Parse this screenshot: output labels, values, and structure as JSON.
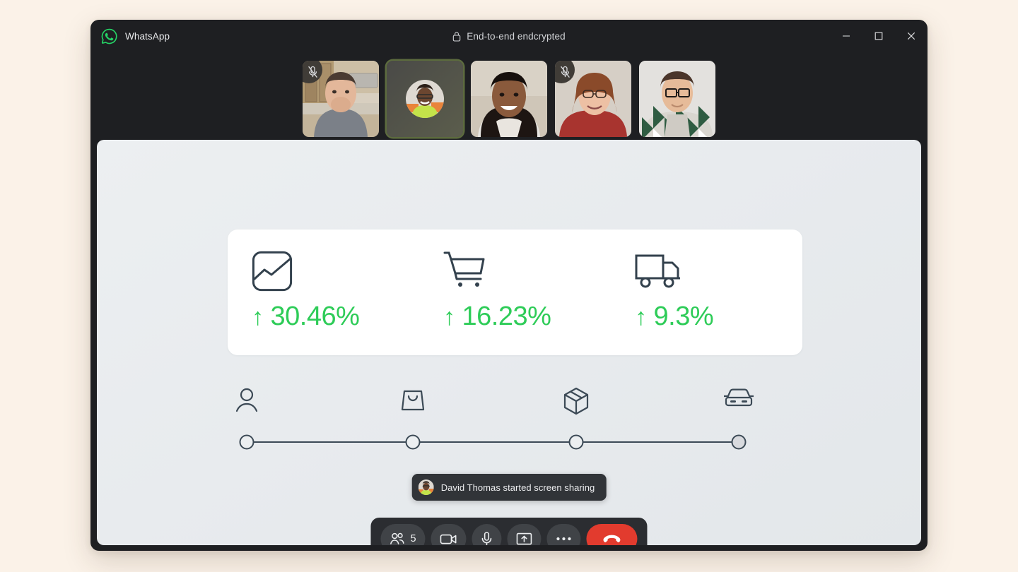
{
  "window": {
    "app_name": "WhatsApp",
    "encryption_label": "End-to-end endcrypted",
    "lock_icon": "lock-icon",
    "logo_icon": "whatsapp-logo-icon",
    "controls": {
      "minimize": "minimize-icon",
      "maximize": "maximize-icon",
      "close": "close-icon"
    }
  },
  "participants": [
    {
      "id": "p1",
      "camera_on": true,
      "muted": true,
      "active_speaker": false,
      "mute_icon": "mic-off-icon"
    },
    {
      "id": "p2",
      "camera_on": false,
      "muted": false,
      "active_speaker": true,
      "mute_icon": ""
    },
    {
      "id": "p3",
      "camera_on": true,
      "muted": false,
      "active_speaker": false,
      "mute_icon": ""
    },
    {
      "id": "p4",
      "camera_on": true,
      "muted": true,
      "active_speaker": false,
      "mute_icon": "mic-off-icon"
    },
    {
      "id": "p5",
      "camera_on": true,
      "muted": false,
      "active_speaker": false,
      "mute_icon": ""
    }
  ],
  "shared_screen": {
    "stats": [
      {
        "icon": "chart-image-icon",
        "direction": "up",
        "arrow": "↑",
        "value": "30.46%"
      },
      {
        "icon": "shopping-cart-icon",
        "direction": "up",
        "arrow": "↑",
        "value": "16.23%"
      },
      {
        "icon": "delivery-truck-icon",
        "direction": "up",
        "arrow": "↑",
        "value": "9.3%"
      }
    ],
    "stat_color": "#2ecc58",
    "stepper": [
      {
        "icon": "person-icon",
        "state": "empty"
      },
      {
        "icon": "shopping-bag-icon",
        "state": "empty"
      },
      {
        "icon": "package-box-icon",
        "state": "empty"
      },
      {
        "icon": "car-icon",
        "state": "filled"
      }
    ]
  },
  "toast": {
    "avatar": "participant-avatar",
    "message": "David Thomas started screen sharing"
  },
  "call_controls": [
    {
      "name": "participants-button",
      "icon": "people-icon",
      "count": "5"
    },
    {
      "name": "camera-button",
      "icon": "video-camera-icon",
      "count": ""
    },
    {
      "name": "microphone-button",
      "icon": "microphone-icon",
      "count": ""
    },
    {
      "name": "share-screen-button",
      "icon": "share-screen-icon",
      "count": ""
    },
    {
      "name": "more-options-button",
      "icon": "more-horizontal-icon",
      "count": ""
    },
    {
      "name": "end-call-button",
      "icon": "hangup-phone-icon",
      "count": ""
    }
  ]
}
